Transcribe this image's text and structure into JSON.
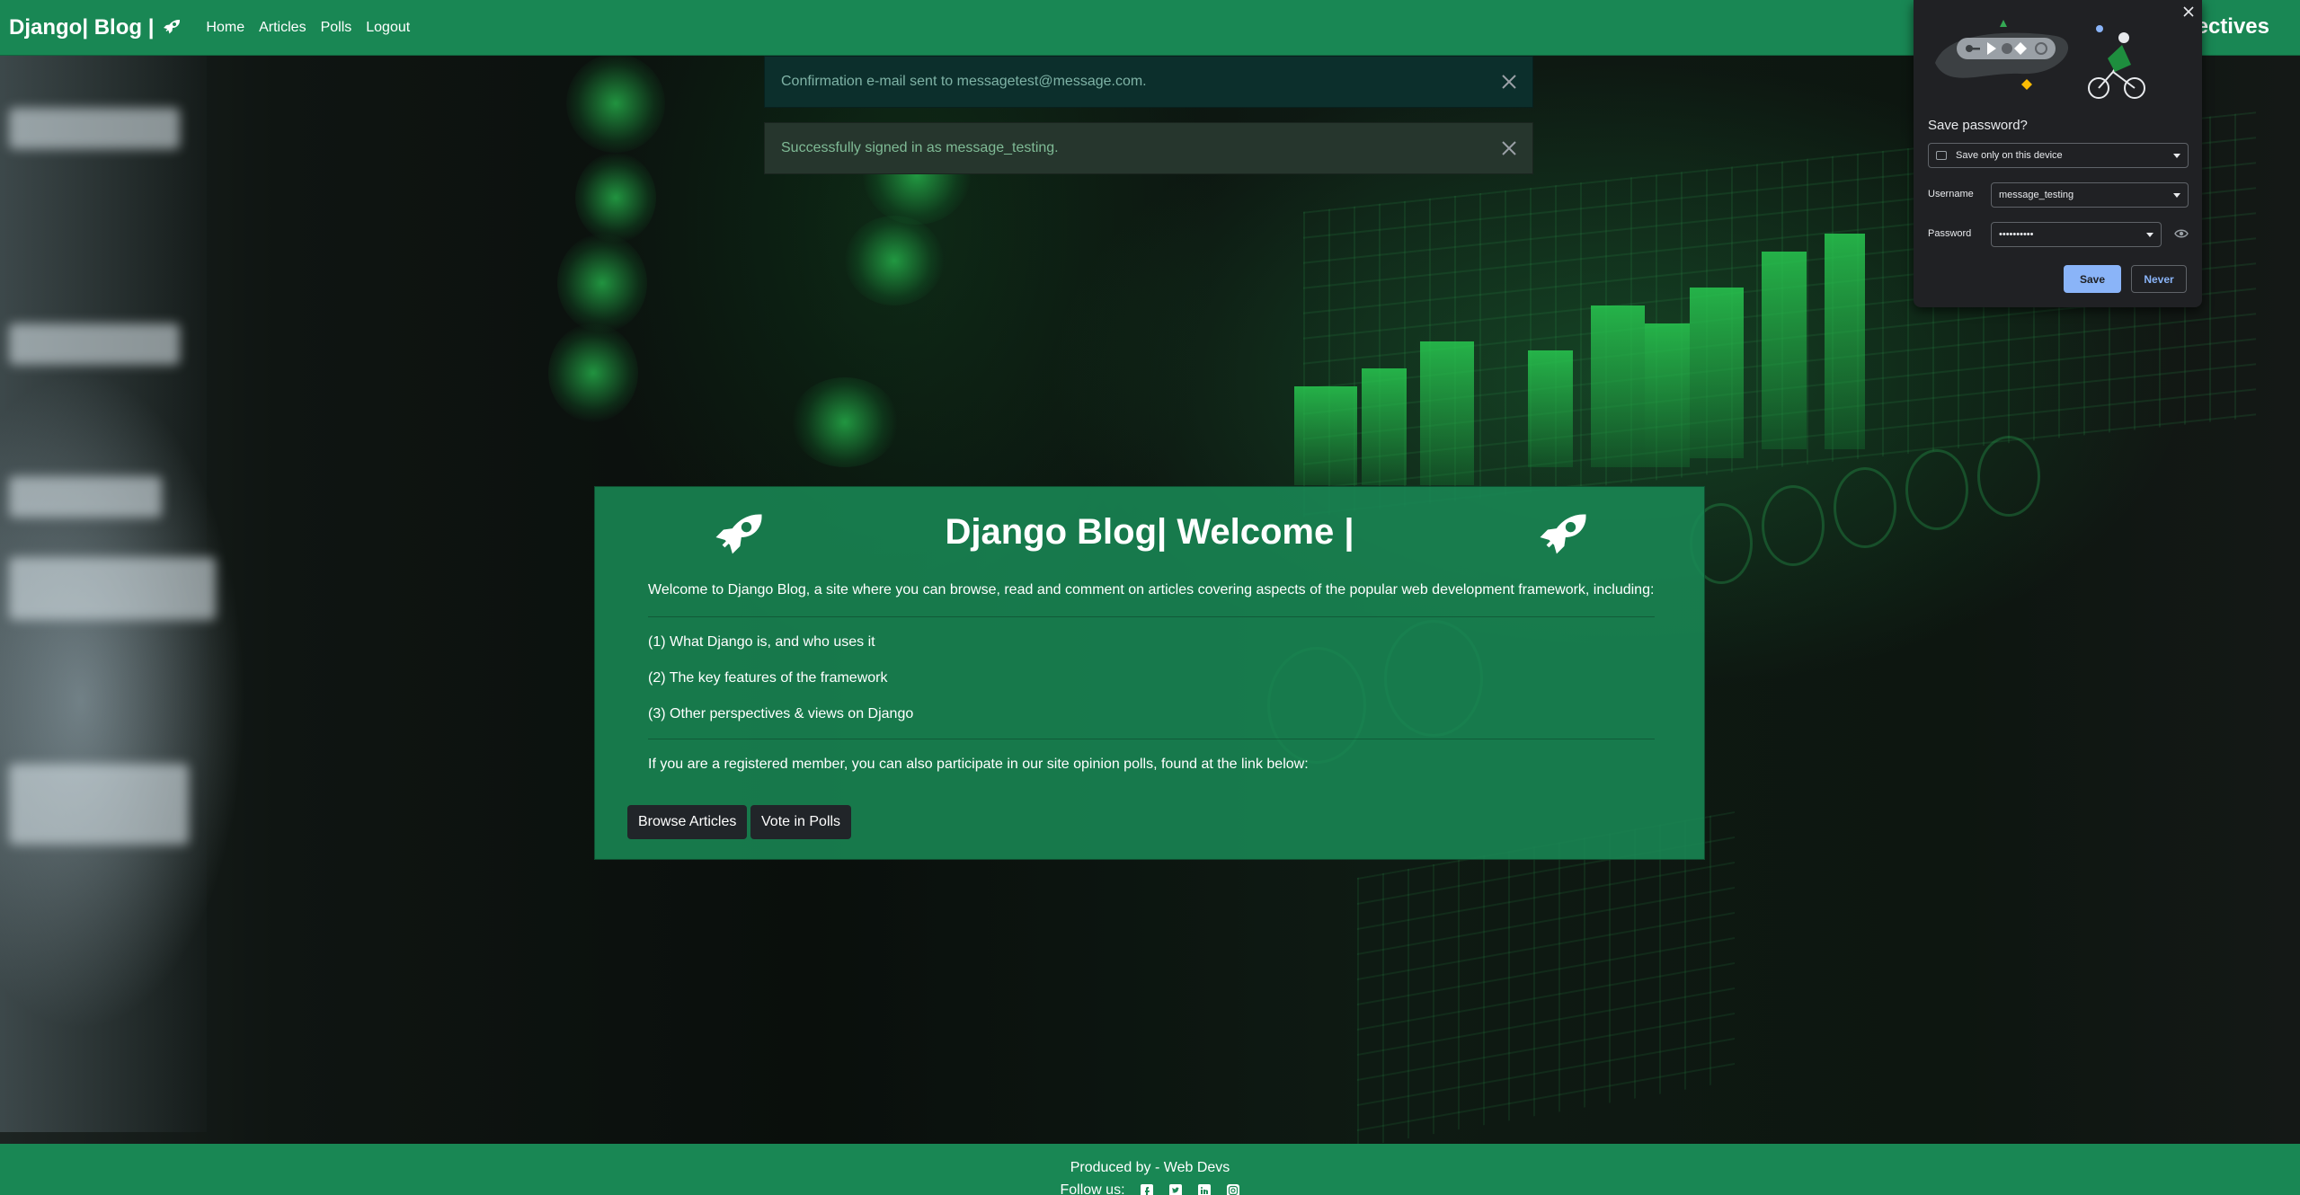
{
  "navbar": {
    "brand": "Django| Blog |",
    "links": [
      "Home",
      "Articles",
      "Polls",
      "Logout"
    ],
    "right_text": "rspectives"
  },
  "alerts": [
    {
      "text": "Confirmation e-mail sent to messagetest@message.com."
    },
    {
      "text": "Successfully signed in as message_testing."
    }
  ],
  "welcome": {
    "title": "Django Blog| Welcome |",
    "intro": "Welcome to Django Blog, a site where you can browse, read and comment on articles covering aspects of the popular web development framework, including:",
    "points": [
      "(1) What Django is, and who uses it",
      "(2) The key features of the framework",
      "(3) Other perspectives & views on Django"
    ],
    "polls_text": "If you are a registered member, you can also participate in our site opinion polls, found at the link below:",
    "buttons": {
      "browse": "Browse Articles",
      "vote": "Vote in Polls"
    }
  },
  "footer": {
    "produced": "Produced by - Web Devs",
    "follow": "Follow us:",
    "social_icons": [
      "facebook-icon",
      "twitter-icon",
      "linkedin-icon",
      "instagram-icon"
    ]
  },
  "password_popup": {
    "heading": "Save password?",
    "storage_option": "Save only on this device",
    "username_label": "Username",
    "username_value": "message_testing",
    "password_label": "Password",
    "password_value": "••••••••••",
    "save_label": "Save",
    "never_label": "Never"
  },
  "colors": {
    "primary_green": "#198754",
    "dark_button": "#212529",
    "popup_bg": "#202124",
    "popup_accent": "#8ab4f8"
  }
}
